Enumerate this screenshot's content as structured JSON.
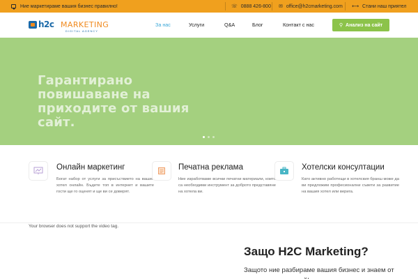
{
  "topbar": {
    "tagline": "Ние маркетираме вашия бизнес правилно!",
    "phone": "0888 426-800",
    "email": "office@h2cmarketing.com",
    "partner": "Стани наш приятел",
    "icons": {
      "tagline": "chat-bubble-icon",
      "phone": "phone-icon",
      "email": "envelope-icon",
      "partner": "share-icon"
    }
  },
  "logo": {
    "brand": "h2c",
    "word": "MARKETING",
    "sub": "DIGITAL AGENCY"
  },
  "nav": {
    "items": [
      "За нас",
      "Услуги",
      "Q&A",
      "Блог",
      "Контакт с нас"
    ],
    "active": "За нас"
  },
  "cta": {
    "label": "Анализ на сайт",
    "icon": "search-icon"
  },
  "hero": {
    "title": "Гарантирано повишаване на приходите от вашия сайт.",
    "slides": 3,
    "active_slide": 1
  },
  "services": [
    {
      "title": "Онлайн маркетинг",
      "text": "Богат набор от услуги за присъствието на вашия хотел онлайн. Бъдете топ в интернет и вашите гости ще го оценят и ще ви се доверят.",
      "icon": "chart-presentation-icon"
    },
    {
      "title": "Печатна реклама",
      "text": "Ние изработваме всички печатни материали, които са необходими инструмент за доброто представяне на хотела ви.",
      "icon": "printed-page-icon"
    },
    {
      "title": "Хотелски консултации",
      "text": "Като активно работещи в хотелския бранш може да ви предложим професионални съвети за развитие на вашия хотел или верига.",
      "icon": "suitcase-icon"
    }
  ],
  "video_note": "Your browser does not support the video tag.",
  "why": {
    "title": "Защо H2C Marketing?",
    "text": "Защото ние разбираме вашия бизнес и знаем от какво има нужда той!"
  },
  "colors": {
    "topbar": "#f0a01e",
    "accent": "#3aa7d8",
    "hero": "#a4d07f",
    "cta": "#8cc34a",
    "brand_blue": "#1c6aa8",
    "brand_orange": "#f08a1e"
  }
}
